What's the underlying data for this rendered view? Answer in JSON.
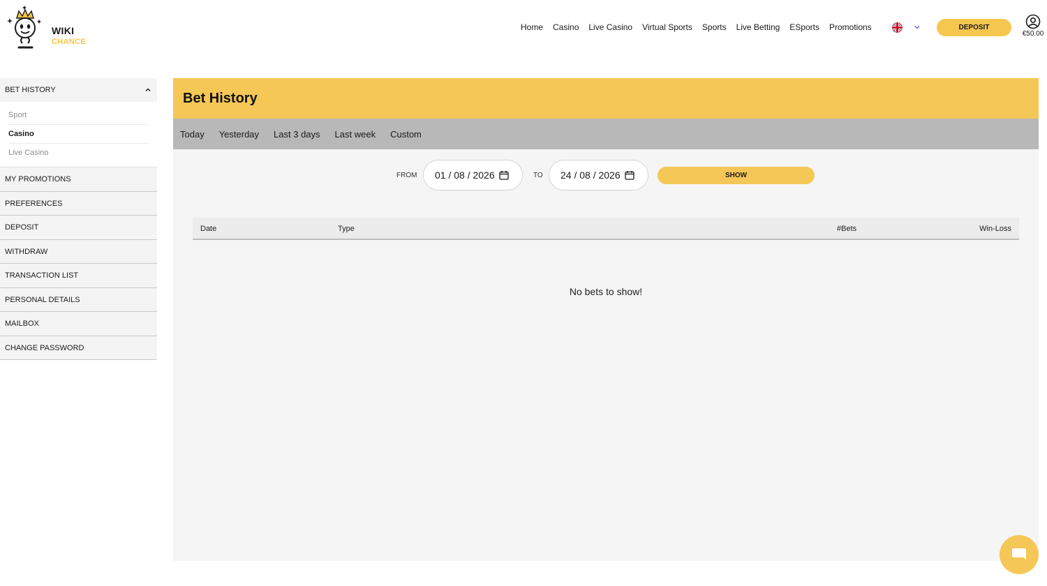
{
  "brand": {
    "line1": "WIKI",
    "line2": "CHANCE"
  },
  "nav": [
    "Home",
    "Casino",
    "Live Casino",
    "Virtual Sports",
    "Sports",
    "Live Betting",
    "ESports",
    "Promotions"
  ],
  "header": {
    "deposit_label": "DEPOSIT",
    "balance": "€50.00"
  },
  "sidebar": {
    "bet_history": "BET HISTORY",
    "sub_items": [
      "Sport",
      "Casino",
      "Live Casino"
    ],
    "items": [
      "MY PROMOTIONS",
      "PREFERENCES",
      "DEPOSIT",
      "WITHDRAW",
      "TRANSACTION LIST",
      "PERSONAL DETAILS",
      "MAILBOX",
      "CHANGE PASSWORD"
    ]
  },
  "main": {
    "title": "Bet History",
    "filters": [
      "Today",
      "Yesterday",
      "Last 3 days",
      "Last week",
      "Custom"
    ],
    "from_label": "FROM",
    "from_value": "01 / 08 / 2026",
    "to_label": "TO",
    "to_value": "24 / 08 / 2026",
    "show_label": "SHOW",
    "columns": [
      "Date",
      "Type",
      "#Bets",
      "Win-Loss"
    ],
    "empty_message": "No bets to show!"
  },
  "colors": {
    "accent": "#f5c756",
    "filter_bar": "#b8b8b8",
    "panel": "#f5f5f5"
  }
}
